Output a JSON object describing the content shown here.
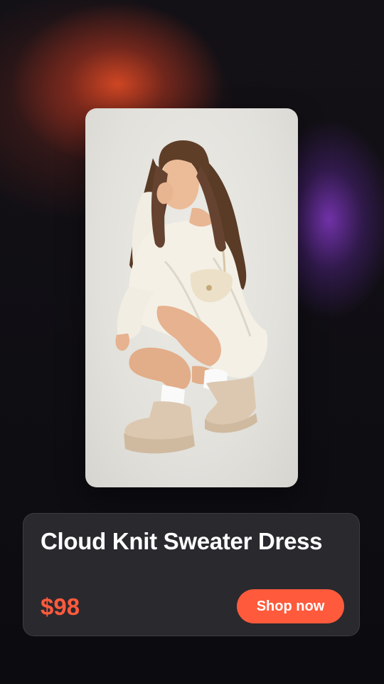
{
  "product": {
    "title": "Cloud Knit Sweater Dress",
    "price": "$98",
    "image_alt": "Model crouching in a cream off-shoulder knit sweater dress with shoulder bag and suede platform boots"
  },
  "actions": {
    "shop_label": "Shop now"
  },
  "colors": {
    "accent": "#ff5a3c",
    "panel": "#2a292e",
    "background": "#0e0d12",
    "glow_orange": "#d64824",
    "glow_purple": "#7634b0"
  }
}
